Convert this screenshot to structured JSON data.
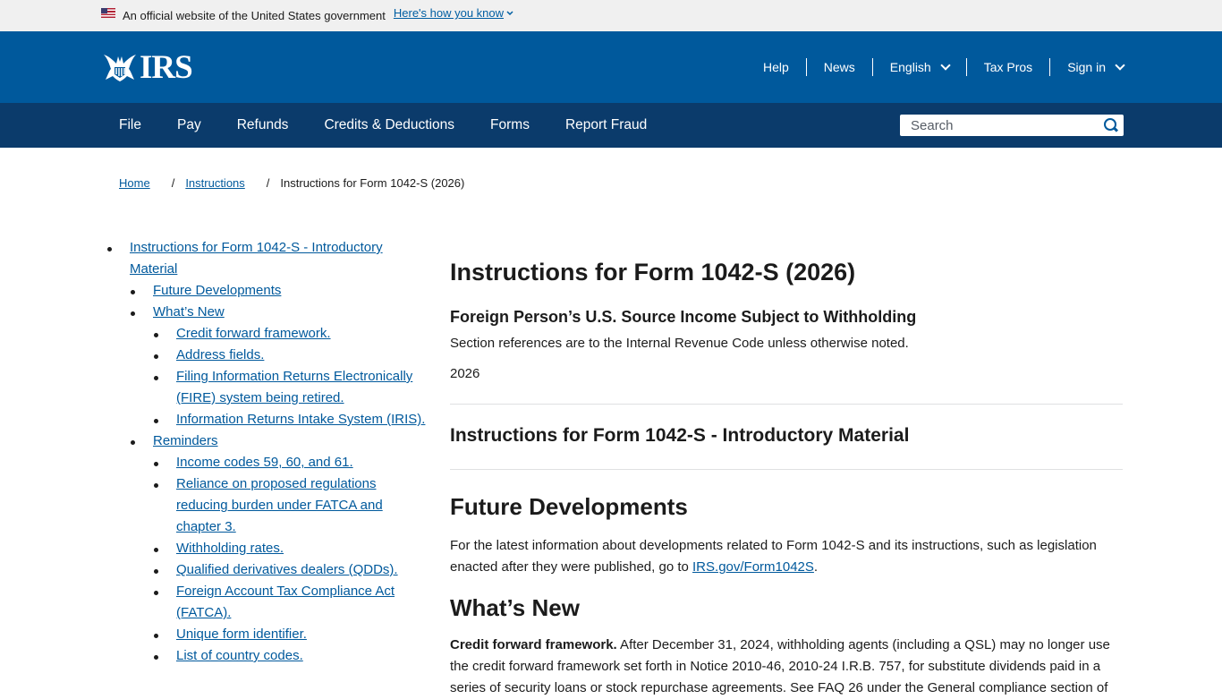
{
  "gov_banner": {
    "text": "An official website of the United States government",
    "link_label": "Here's how you know"
  },
  "header": {
    "logo_text": "IRS",
    "utility_nav": [
      "Help",
      "News",
      "English",
      "Tax Pros",
      "Sign in"
    ]
  },
  "primary_nav": {
    "items": [
      "File",
      "Pay",
      "Refunds",
      "Credits & Deductions",
      "Forms",
      "Report Fraud"
    ],
    "search_placeholder": "Search"
  },
  "breadcrumb": {
    "home": "Home",
    "instructions": "Instructions",
    "separator": "/",
    "current": "Instructions for Form 1042-S (2026)"
  },
  "toc": {
    "top": "Instructions for Form 1042-S - Introductory Material",
    "future": "Future Developments",
    "whats_new": "What’s New",
    "whats_new_items": [
      "Credit forward framework.",
      "Address fields.",
      "Filing Information Returns Electronically (FIRE) system being retired.",
      "Information Returns Intake System (IRIS)."
    ],
    "reminders": "Reminders",
    "reminder_items": [
      "Income codes 59, 60, and 61.",
      "Reliance on proposed regulations reducing burden under FATCA and chapter 3.",
      "Withholding rates.",
      "Qualified derivatives dealers (QDDs).",
      "Foreign Account Tax Compliance Act (FATCA).",
      "Unique form identifier.",
      "List of country codes."
    ]
  },
  "main": {
    "title": "Instructions for Form 1042-S (2026)",
    "subtitle": "Foreign Person’s U.S. Source Income Subject to Withholding",
    "section_ref": "Section references are to the Internal Revenue Code unless otherwise noted.",
    "year": "2026",
    "intro_title": "Instructions for Form 1042-S - Introductory Material",
    "future_heading": "Future Developments",
    "future_text": "For the latest information about developments related to Form 1042-S and its instructions, such as legislation enacted after they were published, go to ",
    "future_link": "IRS.gov/Form1042S",
    "future_end": ".",
    "whats_new_heading": "What’s New",
    "credit_lead": "Credit forward framework.",
    "credit_text": " After December 31, 2024, withholding agents (including a QSL) may no longer use the credit forward framework set forth in Notice 2010-46, 2010-24 I.R.B. 757, for substitute dividends paid in a series of security loans or stock repurchase agreements. See FAQ 26 under the General compliance section of"
  }
}
